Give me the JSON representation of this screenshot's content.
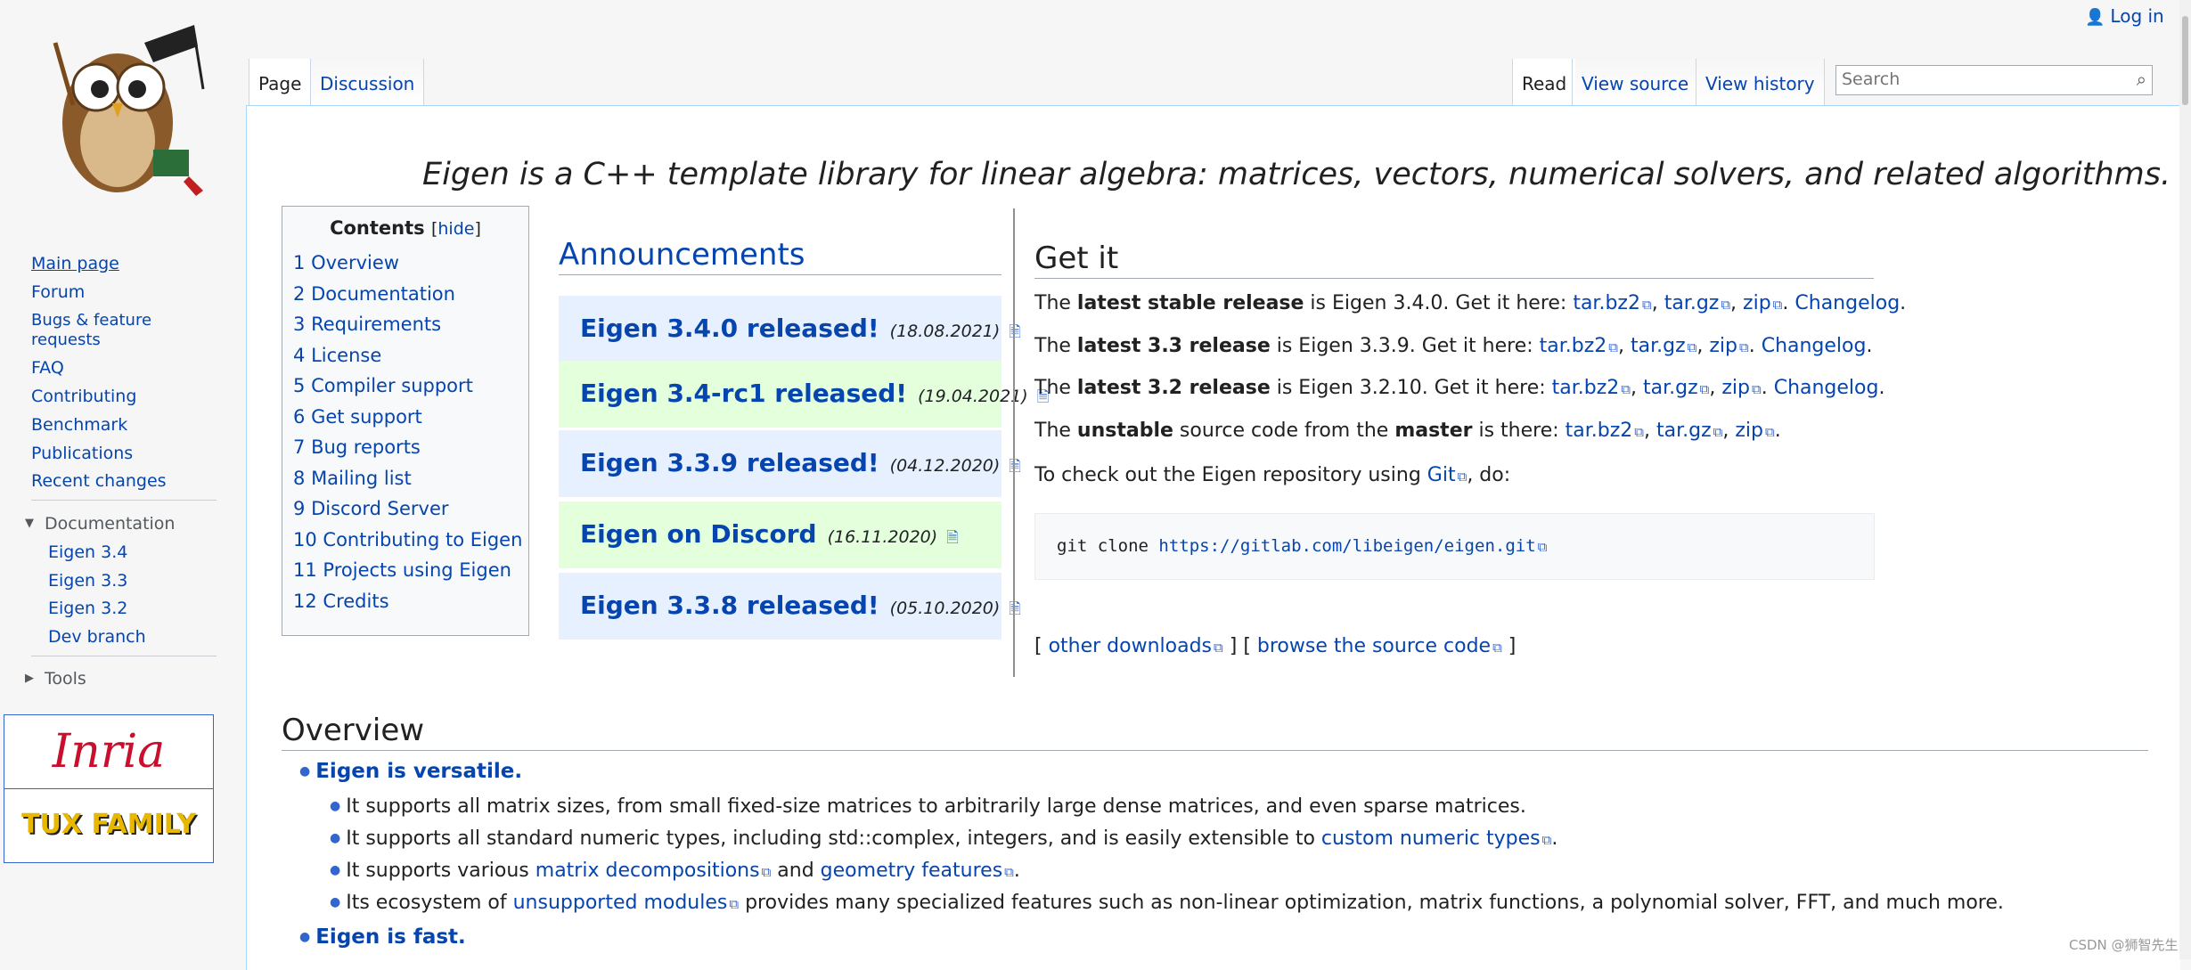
{
  "header": {
    "login": "Log in",
    "tabs_left": [
      "Page",
      "Discussion"
    ],
    "tabs_right": [
      "Read",
      "View source",
      "View history"
    ],
    "search_placeholder": "Search"
  },
  "sidebar": {
    "nav": [
      "Main page",
      "Forum",
      "Bugs & feature",
      "requests",
      "FAQ",
      "Contributing",
      "Benchmark",
      "Publications",
      "Recent changes"
    ],
    "documentation": {
      "label": "Documentation",
      "items": [
        "Eigen 3.4",
        "Eigen 3.3",
        "Eigen 3.2",
        "Dev branch"
      ]
    },
    "tools": "Tools",
    "logos": [
      "Inria",
      "TUX FAMILY"
    ]
  },
  "tagline": "Eigen is a C++ template library for linear algebra: matrices, vectors, numerical solvers, and related algorithms.",
  "toc": {
    "title": "Contents",
    "hide": "hide",
    "items": [
      {
        "num": "1",
        "label": "Overview"
      },
      {
        "num": "2",
        "label": "Documentation"
      },
      {
        "num": "3",
        "label": "Requirements"
      },
      {
        "num": "4",
        "label": "License"
      },
      {
        "num": "5",
        "label": "Compiler support"
      },
      {
        "num": "6",
        "label": "Get support"
      },
      {
        "num": "7",
        "label": "Bug reports"
      },
      {
        "num": "8",
        "label": "Mailing list"
      },
      {
        "num": "9",
        "label": "Discord Server"
      },
      {
        "num": "10",
        "label": "Contributing to Eigen"
      },
      {
        "num": "11",
        "label": "Projects using Eigen"
      },
      {
        "num": "12",
        "label": "Credits"
      }
    ]
  },
  "announcements": {
    "heading": "Announcements",
    "items": [
      {
        "title": "Eigen 3.4.0 released!",
        "date": "(18.08.2021)"
      },
      {
        "title": "Eigen 3.4-rc1 released!",
        "date": "(19.04.2021)"
      },
      {
        "title": "Eigen 3.3.9 released!",
        "date": "(04.12.2020)"
      },
      {
        "title": "Eigen on Discord",
        "date": "(16.11.2020)"
      },
      {
        "title": "Eigen 3.3.8 released!",
        "date": "(05.10.2020)"
      }
    ]
  },
  "getit": {
    "heading": "Get it",
    "lines": [
      {
        "pre": "The ",
        "bold": "latest stable release",
        "mid": " is Eigen 3.4.0. Get it here: "
      },
      {
        "pre": "The ",
        "bold": "latest 3.3 release",
        "mid": " is Eigen 3.3.9. Get it here: "
      },
      {
        "pre": "The ",
        "bold": "latest 3.2 release",
        "mid": " is Eigen 3.2.10. Get it here: "
      }
    ],
    "unstable": {
      "pre": "The ",
      "bold1": "unstable",
      "mid": " source code from the ",
      "bold2": "master",
      "post": " is there: "
    },
    "links": {
      "tarbz2": "tar.bz2",
      "targz": "tar.gz",
      "zip": "zip",
      "changelog": "Changelog"
    },
    "checkout_pre": "To check out the Eigen repository using ",
    "checkout_link": "Git",
    "checkout_post": ", do:",
    "code_cmd": "git clone ",
    "code_url": "https://gitlab.com/libeigen/eigen.git",
    "other_downloads": "other downloads",
    "browse_source": "browse the source code"
  },
  "overview": {
    "heading": "Overview",
    "versatile": "Eigen is versatile.",
    "bullets": [
      {
        "text": "It supports all matrix sizes, from small fixed-size matrices to arbitrarily large dense matrices, and even sparse matrices."
      },
      {
        "text": "It supports all standard numeric types, including std::complex, integers, and is easily extensible to ",
        "link": "custom numeric types",
        "post": "."
      },
      {
        "text": "It supports various ",
        "link": "matrix decompositions",
        "mid": " and ",
        "link2": "geometry features",
        "post": "."
      },
      {
        "text": "Its ecosystem of ",
        "link": "unsupported modules",
        "post": " provides many specialized features such as non-linear optimization, matrix functions, a polynomial solver, FFT, and much more."
      }
    ],
    "fast": "Eigen is fast."
  },
  "watermark": "CSDN @狮智先生"
}
